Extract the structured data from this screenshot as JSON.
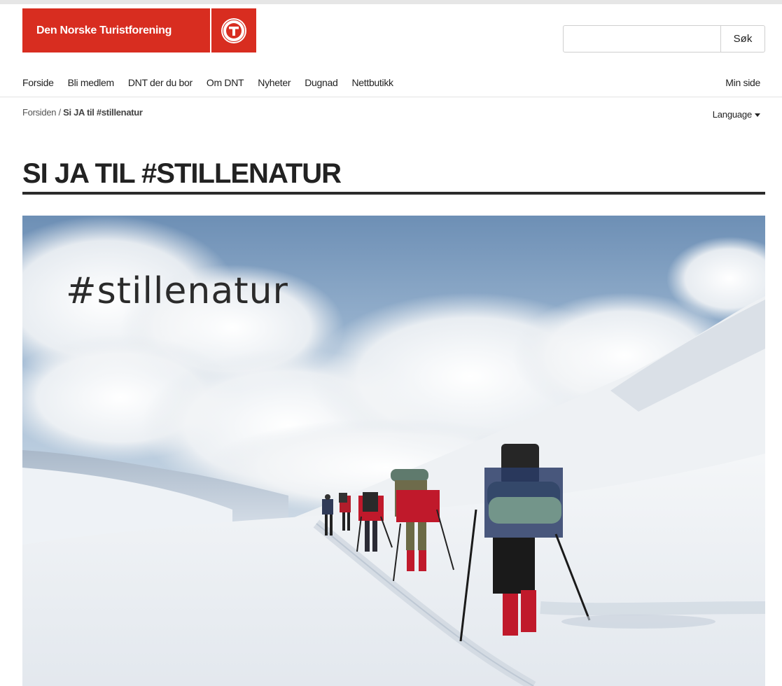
{
  "header": {
    "logo_text": "Den Norske Turistforening",
    "search": {
      "placeholder": "",
      "button_label": "Søk"
    }
  },
  "nav": {
    "items": [
      {
        "label": "Forside"
      },
      {
        "label": "Bli medlem"
      },
      {
        "label": "DNT der du bor"
      },
      {
        "label": "Om DNT"
      },
      {
        "label": "Nyheter"
      },
      {
        "label": "Dugnad"
      },
      {
        "label": "Nettbutikk"
      }
    ],
    "min_side": "Min side"
  },
  "breadcrumb": {
    "home": "Forsiden",
    "separator": " / ",
    "current": "Si JA til #stillenatur"
  },
  "language": {
    "label": "Language"
  },
  "page": {
    "title": "SI JA TIL #STILLENATUR",
    "hero_caption": "#stillenatur"
  },
  "colors": {
    "brand_red": "#d82d20",
    "title_rule": "#2b2b2b",
    "text": "#222222"
  },
  "icons": {
    "logo_emblem": "dnt-logo-icon",
    "language_caret": "caret-down-icon"
  }
}
